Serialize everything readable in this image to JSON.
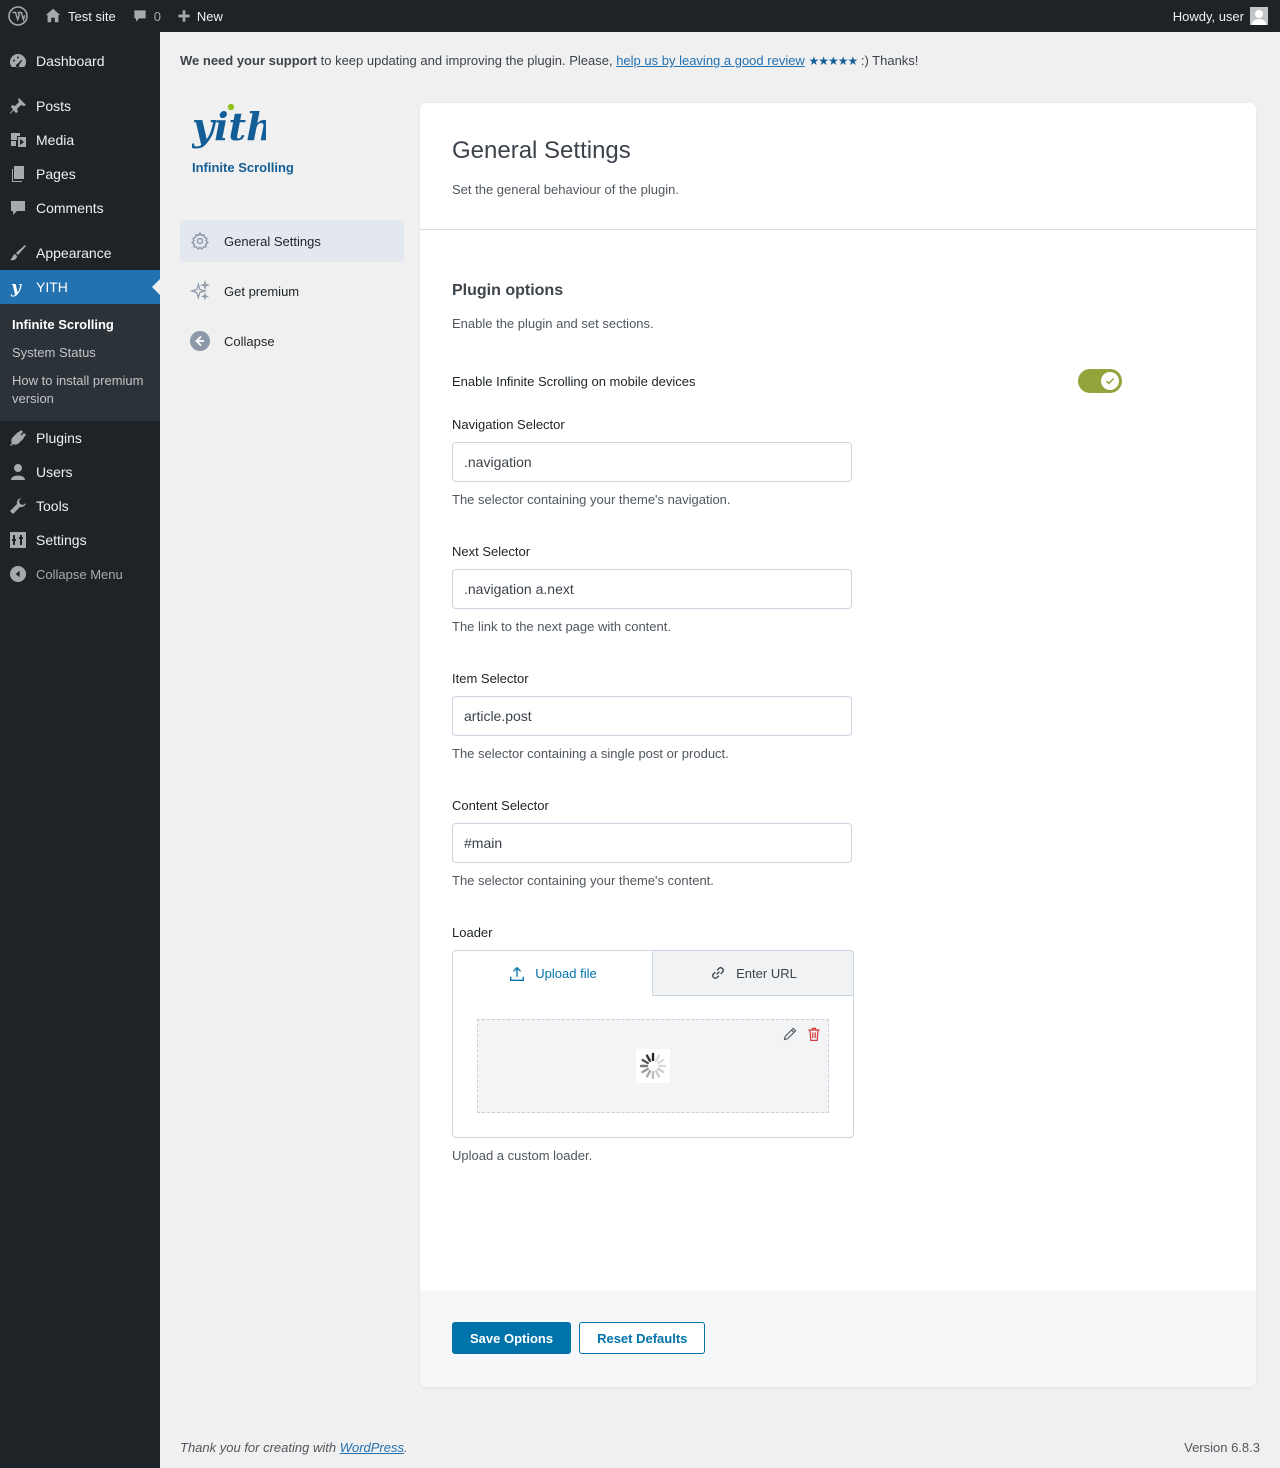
{
  "adminbar": {
    "site_name": "Test site",
    "comments_count": "0",
    "new_label": "New",
    "greeting": "Howdy, user"
  },
  "sidebar": {
    "items": [
      {
        "label": "Dashboard",
        "icon": "dashboard-icon"
      },
      {
        "label": "Posts",
        "icon": "pin-icon"
      },
      {
        "label": "Media",
        "icon": "media-icon"
      },
      {
        "label": "Pages",
        "icon": "pages-icon"
      },
      {
        "label": "Comments",
        "icon": "comment-icon"
      },
      {
        "label": "Appearance",
        "icon": "brush-icon"
      },
      {
        "label": "YITH",
        "icon": "yith-icon"
      },
      {
        "label": "Plugins",
        "icon": "plugin-icon"
      },
      {
        "label": "Users",
        "icon": "user-icon"
      },
      {
        "label": "Tools",
        "icon": "wrench-icon"
      },
      {
        "label": "Settings",
        "icon": "settings-icon"
      }
    ],
    "submenu": [
      "Infinite Scrolling",
      "System Status",
      "How to install premium version"
    ],
    "collapse_label": "Collapse Menu"
  },
  "notice": {
    "bold": "We need your support",
    "text": " to keep updating and improving the plugin. Please, ",
    "link": "help us by leaving a good review",
    "stars": "★★★★★",
    "end": " :) Thanks!"
  },
  "plugin": {
    "logo_text": "yith",
    "title": "Infinite Scrolling"
  },
  "panel_nav": [
    {
      "label": "General Settings",
      "icon": "gear-icon"
    },
    {
      "label": "Get premium",
      "icon": "sparkle-icon"
    },
    {
      "label": "Collapse",
      "icon": "arrow-left-circle-icon"
    }
  ],
  "card": {
    "title": "General Settings",
    "subtitle": "Set the general behaviour of the plugin.",
    "section_title": "Plugin options",
    "section_desc": "Enable the plugin and set sections.",
    "toggle_label": "Enable Infinite Scrolling on mobile devices",
    "toggle_on": true,
    "fields": [
      {
        "label": "Navigation Selector",
        "value": ".navigation",
        "desc": "The selector containing your theme's navigation."
      },
      {
        "label": "Next Selector",
        "value": ".navigation a.next",
        "desc": "The link to the next page with content."
      },
      {
        "label": "Item Selector",
        "value": "article.post",
        "desc": "The selector containing a single post or product."
      },
      {
        "label": "Content Selector",
        "value": "#main",
        "desc": "The selector containing your theme's content."
      }
    ],
    "loader": {
      "label": "Loader",
      "tab_upload": "Upload file",
      "tab_url": "Enter URL",
      "desc": "Upload a custom loader."
    },
    "save_label": "Save Options",
    "reset_label": "Reset Defaults"
  },
  "footer": {
    "text": "Thank you for creating with ",
    "link": "WordPress",
    "period": ".",
    "version": "Version 6.8.3"
  },
  "colors": {
    "accent": "#0073aa",
    "wp_blue": "#2271b1",
    "toggle": "#94a43c",
    "delete": "#d63638"
  }
}
